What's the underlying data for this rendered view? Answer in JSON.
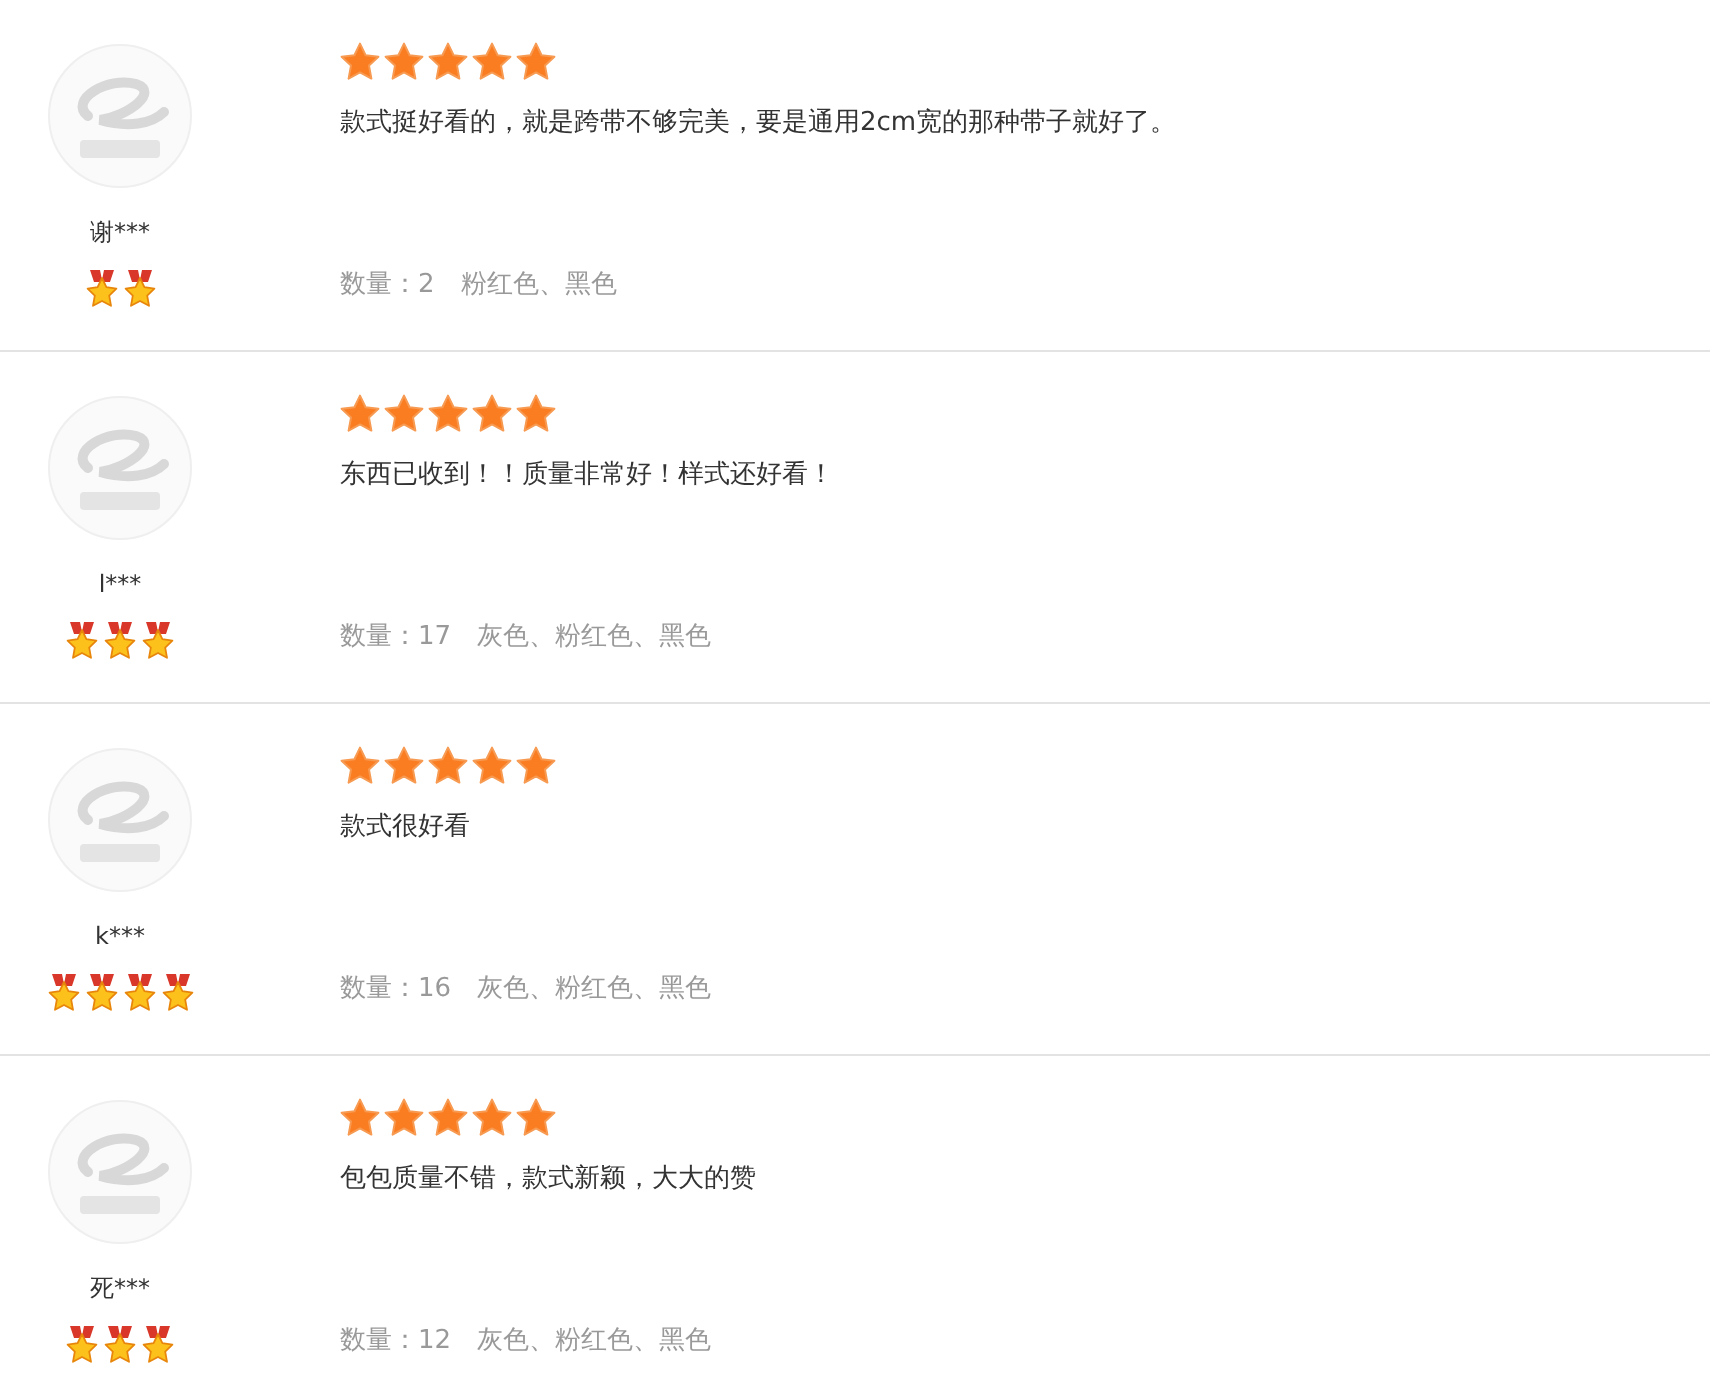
{
  "reviews": [
    {
      "user": "谢***",
      "buyer_badges": [
        {
          "kind": "medal"
        },
        {
          "kind": "medal"
        }
      ],
      "rating": {
        "stars": 5
      },
      "text": "款式挺好看的，就是跨带不够完美，要是通用2cm宽的那种带子就好了。",
      "quantity": "数量：2",
      "colors": "粉红色、黑色"
    },
    {
      "user": "l***",
      "buyer_badges": [
        {
          "kind": "medal"
        },
        {
          "kind": "medal"
        },
        {
          "kind": "medal"
        }
      ],
      "rating": {
        "stars": 5
      },
      "text": "东西已收到！！质量非常好！样式还好看！",
      "quantity": "数量：17",
      "colors": "灰色、粉红色、黑色"
    },
    {
      "user": "k***",
      "buyer_badges": [
        {
          "kind": "medal"
        },
        {
          "kind": "medal"
        },
        {
          "kind": "medal"
        },
        {
          "kind": "medal"
        }
      ],
      "rating": {
        "stars": 5
      },
      "text": "款式很好看",
      "quantity": "数量：16",
      "colors": "灰色、粉红色、黑色"
    },
    {
      "user": "死***",
      "buyer_badges": [
        {
          "kind": "medal"
        },
        {
          "kind": "medal"
        },
        {
          "kind": "medal"
        }
      ],
      "rating": {
        "stars": 5
      },
      "text": "包包质量不错，款式新颖，大大的赞",
      "quantity": "数量：12",
      "colors": "灰色、粉红色、黑色"
    }
  ]
}
